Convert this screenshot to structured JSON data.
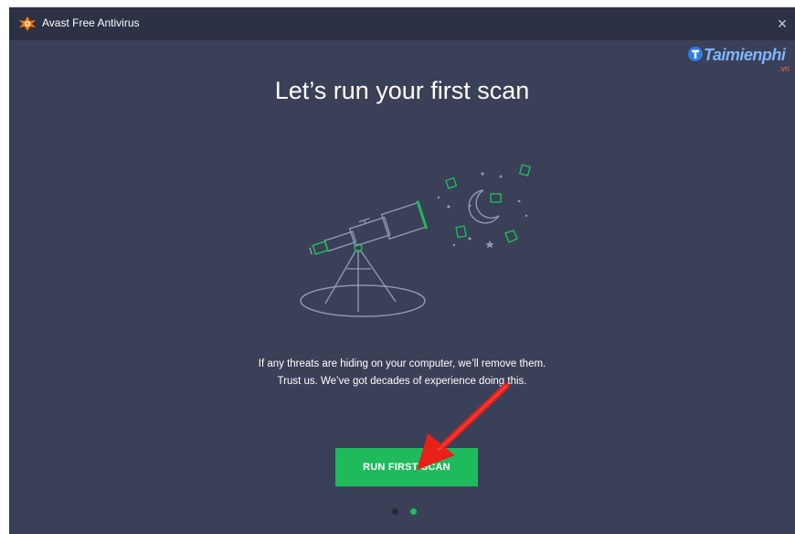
{
  "window": {
    "title": "Avast Free Antivirus",
    "close_glyph": "×",
    "logo_icon": "avast-logo-icon"
  },
  "watermark": {
    "text": "Taimienphi",
    "sub": ".vn"
  },
  "main": {
    "heading": "Let’s run your first scan",
    "description_line1": "If any threats are hiding on your computer, we’ll remove them.",
    "description_line2": "Trust us. We’ve got decades of experience doing this.",
    "button_label": "RUN FIRST SCAN",
    "illustration_icon": "telescope-stars-icon"
  },
  "pagination": {
    "total": 2,
    "current": 2
  },
  "colors": {
    "background": "#3a4057",
    "titlebar": "#2c3145",
    "accent_green": "#1fba5c",
    "avast_orange": "#ff7800",
    "annotation_arrow": "#e8201a"
  }
}
